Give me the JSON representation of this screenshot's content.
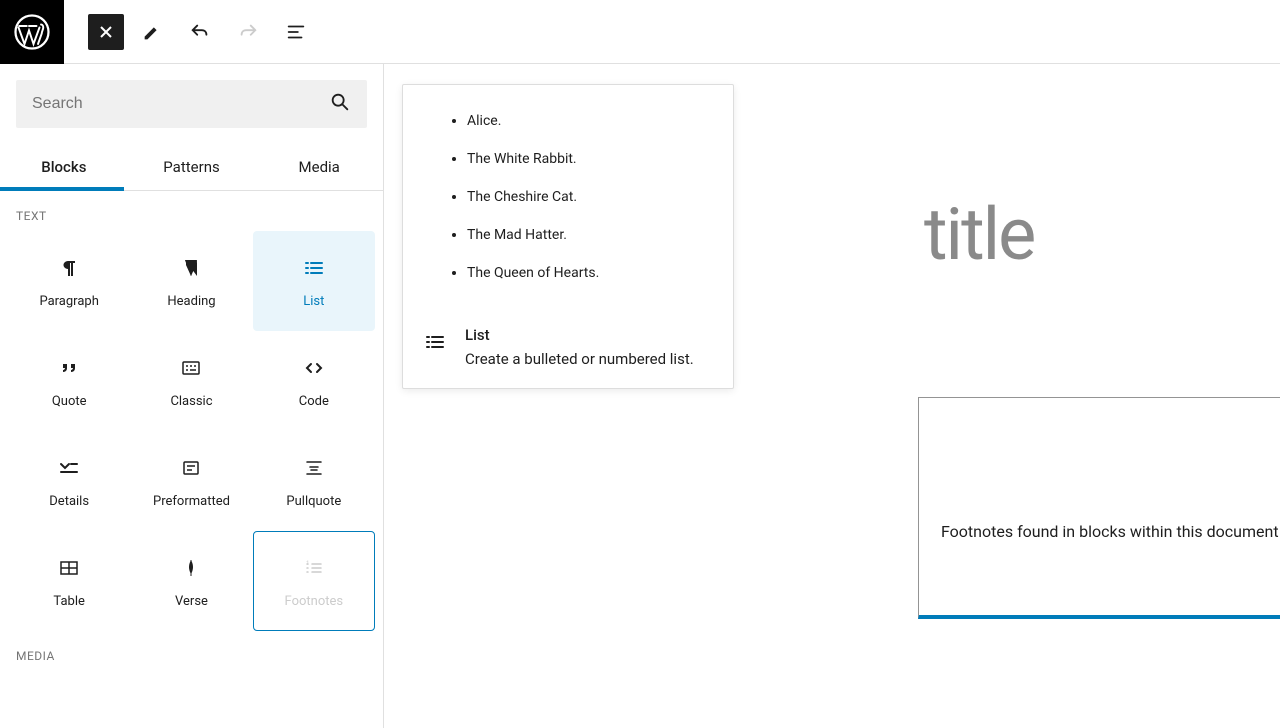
{
  "search": {
    "placeholder": "Search"
  },
  "tabs": {
    "blocks": "Blocks",
    "patterns": "Patterns",
    "media": "Media"
  },
  "sections": {
    "text": "TEXT",
    "media": "MEDIA"
  },
  "blocks": {
    "paragraph": "Paragraph",
    "heading": "Heading",
    "list": "List",
    "quote": "Quote",
    "classic": "Classic",
    "code": "Code",
    "details": "Details",
    "preformatted": "Preformatted",
    "pullquote": "Pullquote",
    "table": "Table",
    "verse": "Verse",
    "footnotes": "Footnotes"
  },
  "canvas": {
    "title_placeholder": "title",
    "footnotes_text": "Footnotes found in blocks within this document will be displayed here."
  },
  "preview": {
    "items": {
      "i0": "Alice.",
      "i1": "The White Rabbit.",
      "i2": "The Cheshire Cat.",
      "i3": "The Mad Hatter.",
      "i4": "The Queen of Hearts."
    },
    "title": "List",
    "desc": "Create a bulleted or numbered list."
  }
}
